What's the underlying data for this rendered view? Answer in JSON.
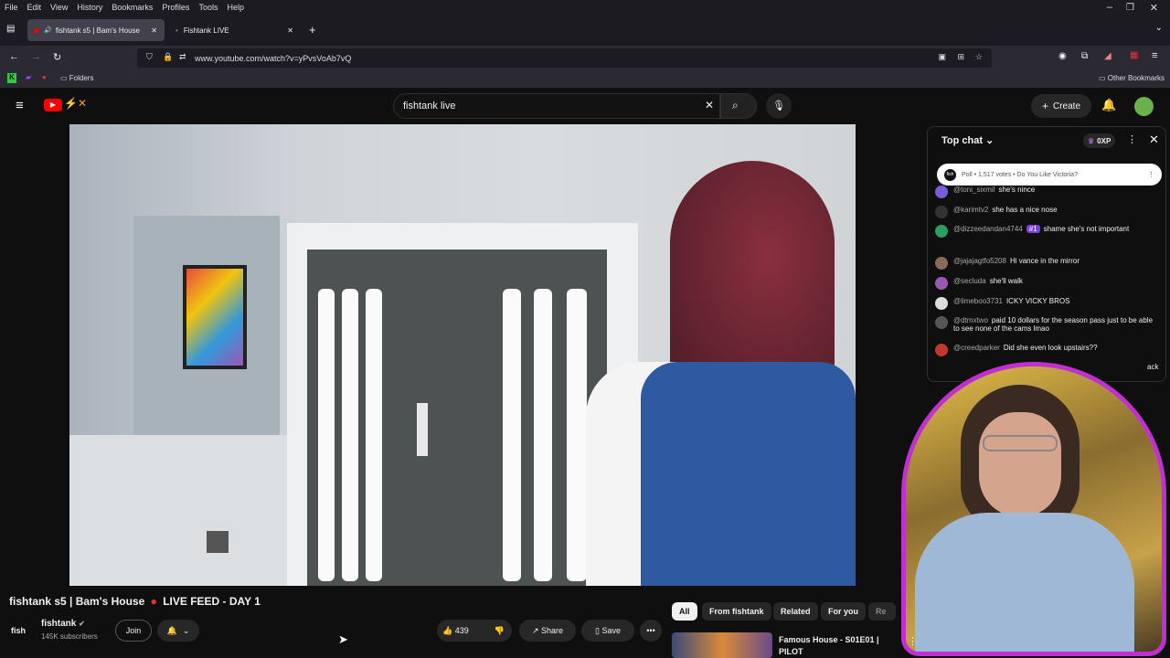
{
  "menubar": {
    "items": [
      "File",
      "Edit",
      "View",
      "History",
      "Bookmarks",
      "Profiles",
      "Tools",
      "Help"
    ]
  },
  "tabs": [
    {
      "label": "fishtank s5 | Bam's House",
      "active": true
    },
    {
      "label": "Fishtank LIVE",
      "active": false
    }
  ],
  "url": "www.youtube.com/watch?v=yPvsVoAb7vQ",
  "bookmarks": {
    "folders": "Folders",
    "other": "Other Bookmarks"
  },
  "search": {
    "value": "fishtank live"
  },
  "header": {
    "create_label": "Create"
  },
  "video": {
    "title": "fishtank s5 | Bam's House",
    "title_suffix": "LIVE FEED - DAY 1"
  },
  "channel": {
    "name": "fishtank",
    "subscribers": "145K subscribers",
    "logo_text": "fish"
  },
  "actions": {
    "join": "Join",
    "likes": "439",
    "share": "Share",
    "save": "Save"
  },
  "chips": [
    "All",
    "From fishtank",
    "Related",
    "For you",
    "Re"
  ],
  "recommended": {
    "title_line1": "Famous House - S01E01 |",
    "title_line2": "PILOT"
  },
  "chat": {
    "mode": "Top chat",
    "xp": "0XP",
    "poll": "Poll • 1,517 votes • Do You Like Victoria?",
    "messages": [
      {
        "user": "@toni_sixmil",
        "text": "she's nince",
        "color": "#7b5cd6"
      },
      {
        "user": "@karimtv2",
        "text": "she has a nice nose",
        "color": "#333"
      },
      {
        "user": "@dizzeedandan4744",
        "badge": "#1",
        "text": "shame she's not important",
        "color": "#2e9b63"
      },
      {
        "user": "@jajajagtfo5208",
        "text": "Hi vance in the mirror",
        "color": "#8a6a5a"
      },
      {
        "user": "@secluda",
        "text": "she'll walk",
        "color": "#9b59b6"
      },
      {
        "user": "@limeboo3731",
        "text": "ICKY VICKY BROS",
        "color": "#ddd"
      },
      {
        "user": "@dtmxtwo",
        "text": "paid 10 dollars for the season pass just to be able to see none of the cams lmao",
        "color": "#555"
      },
      {
        "user": "@creedparker",
        "text": "Did she even look upstairs??",
        "color": "#c0392b"
      }
    ],
    "partial": "ack"
  },
  "colors": {
    "accent": "#ff0000",
    "webcam_border": "#c030d0",
    "badge_purple": "#7b3fe4"
  }
}
